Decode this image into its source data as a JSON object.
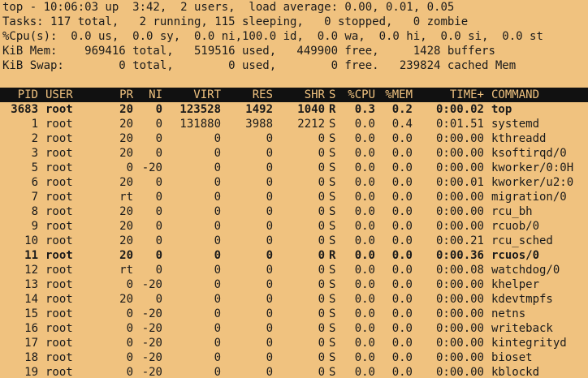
{
  "summary": {
    "line1": "top - 10:06:03 up  3:42,  2 users,  load average: 0.00, 0.01, 0.05",
    "line2": "Tasks: 117 total,   2 running, 115 sleeping,   0 stopped,   0 zombie",
    "line3": "%Cpu(s):  0.0 us,  0.0 sy,  0.0 ni,100.0 id,  0.0 wa,  0.0 hi,  0.0 si,  0.0 st",
    "line4": "KiB Mem:    969416 total,   519516 used,   449900 free,     1428 buffers",
    "line5": "KiB Swap:        0 total,        0 used,        0 free.   239824 cached Mem"
  },
  "columns": [
    "PID",
    "USER",
    "PR",
    "NI",
    "VIRT",
    "RES",
    "SHR",
    "S",
    "%CPU",
    "%MEM",
    "TIME+",
    "COMMAND"
  ],
  "processes": [
    {
      "pid": "3683",
      "user": "root",
      "pr": "20",
      "ni": "0",
      "virt": "123528",
      "res": "1492",
      "shr": "1040",
      "s": "R",
      "cpu": "0.3",
      "mem": "0.2",
      "time": "0:00.02",
      "command": "top",
      "bold": true
    },
    {
      "pid": "1",
      "user": "root",
      "pr": "20",
      "ni": "0",
      "virt": "131880",
      "res": "3988",
      "shr": "2212",
      "s": "S",
      "cpu": "0.0",
      "mem": "0.4",
      "time": "0:01.51",
      "command": "systemd",
      "bold": false
    },
    {
      "pid": "2",
      "user": "root",
      "pr": "20",
      "ni": "0",
      "virt": "0",
      "res": "0",
      "shr": "0",
      "s": "S",
      "cpu": "0.0",
      "mem": "0.0",
      "time": "0:00.00",
      "command": "kthreadd",
      "bold": false
    },
    {
      "pid": "3",
      "user": "root",
      "pr": "20",
      "ni": "0",
      "virt": "0",
      "res": "0",
      "shr": "0",
      "s": "S",
      "cpu": "0.0",
      "mem": "0.0",
      "time": "0:00.00",
      "command": "ksoftirqd/0",
      "bold": false
    },
    {
      "pid": "5",
      "user": "root",
      "pr": "0",
      "ni": "-20",
      "virt": "0",
      "res": "0",
      "shr": "0",
      "s": "S",
      "cpu": "0.0",
      "mem": "0.0",
      "time": "0:00.00",
      "command": "kworker/0:0H",
      "bold": false
    },
    {
      "pid": "6",
      "user": "root",
      "pr": "20",
      "ni": "0",
      "virt": "0",
      "res": "0",
      "shr": "0",
      "s": "S",
      "cpu": "0.0",
      "mem": "0.0",
      "time": "0:00.01",
      "command": "kworker/u2:0",
      "bold": false
    },
    {
      "pid": "7",
      "user": "root",
      "pr": "rt",
      "ni": "0",
      "virt": "0",
      "res": "0",
      "shr": "0",
      "s": "S",
      "cpu": "0.0",
      "mem": "0.0",
      "time": "0:00.00",
      "command": "migration/0",
      "bold": false
    },
    {
      "pid": "8",
      "user": "root",
      "pr": "20",
      "ni": "0",
      "virt": "0",
      "res": "0",
      "shr": "0",
      "s": "S",
      "cpu": "0.0",
      "mem": "0.0",
      "time": "0:00.00",
      "command": "rcu_bh",
      "bold": false
    },
    {
      "pid": "9",
      "user": "root",
      "pr": "20",
      "ni": "0",
      "virt": "0",
      "res": "0",
      "shr": "0",
      "s": "S",
      "cpu": "0.0",
      "mem": "0.0",
      "time": "0:00.00",
      "command": "rcuob/0",
      "bold": false
    },
    {
      "pid": "10",
      "user": "root",
      "pr": "20",
      "ni": "0",
      "virt": "0",
      "res": "0",
      "shr": "0",
      "s": "S",
      "cpu": "0.0",
      "mem": "0.0",
      "time": "0:00.21",
      "command": "rcu_sched",
      "bold": false
    },
    {
      "pid": "11",
      "user": "root",
      "pr": "20",
      "ni": "0",
      "virt": "0",
      "res": "0",
      "shr": "0",
      "s": "R",
      "cpu": "0.0",
      "mem": "0.0",
      "time": "0:00.36",
      "command": "rcuos/0",
      "bold": true
    },
    {
      "pid": "12",
      "user": "root",
      "pr": "rt",
      "ni": "0",
      "virt": "0",
      "res": "0",
      "shr": "0",
      "s": "S",
      "cpu": "0.0",
      "mem": "0.0",
      "time": "0:00.08",
      "command": "watchdog/0",
      "bold": false
    },
    {
      "pid": "13",
      "user": "root",
      "pr": "0",
      "ni": "-20",
      "virt": "0",
      "res": "0",
      "shr": "0",
      "s": "S",
      "cpu": "0.0",
      "mem": "0.0",
      "time": "0:00.00",
      "command": "khelper",
      "bold": false
    },
    {
      "pid": "14",
      "user": "root",
      "pr": "20",
      "ni": "0",
      "virt": "0",
      "res": "0",
      "shr": "0",
      "s": "S",
      "cpu": "0.0",
      "mem": "0.0",
      "time": "0:00.00",
      "command": "kdevtmpfs",
      "bold": false
    },
    {
      "pid": "15",
      "user": "root",
      "pr": "0",
      "ni": "-20",
      "virt": "0",
      "res": "0",
      "shr": "0",
      "s": "S",
      "cpu": "0.0",
      "mem": "0.0",
      "time": "0:00.00",
      "command": "netns",
      "bold": false
    },
    {
      "pid": "16",
      "user": "root",
      "pr": "0",
      "ni": "-20",
      "virt": "0",
      "res": "0",
      "shr": "0",
      "s": "S",
      "cpu": "0.0",
      "mem": "0.0",
      "time": "0:00.00",
      "command": "writeback",
      "bold": false
    },
    {
      "pid": "17",
      "user": "root",
      "pr": "0",
      "ni": "-20",
      "virt": "0",
      "res": "0",
      "shr": "0",
      "s": "S",
      "cpu": "0.0",
      "mem": "0.0",
      "time": "0:00.00",
      "command": "kintegrityd",
      "bold": false
    },
    {
      "pid": "18",
      "user": "root",
      "pr": "0",
      "ni": "-20",
      "virt": "0",
      "res": "0",
      "shr": "0",
      "s": "S",
      "cpu": "0.0",
      "mem": "0.0",
      "time": "0:00.00",
      "command": "bioset",
      "bold": false
    },
    {
      "pid": "19",
      "user": "root",
      "pr": "0",
      "ni": "-20",
      "virt": "0",
      "res": "0",
      "shr": "0",
      "s": "S",
      "cpu": "0.0",
      "mem": "0.0",
      "time": "0:00.00",
      "command": "kblockd",
      "bold": false
    }
  ],
  "colors": {
    "background": "#f0c27f",
    "text": "#1a1a1a",
    "header_background": "#111111",
    "header_text": "#f0c27f"
  }
}
